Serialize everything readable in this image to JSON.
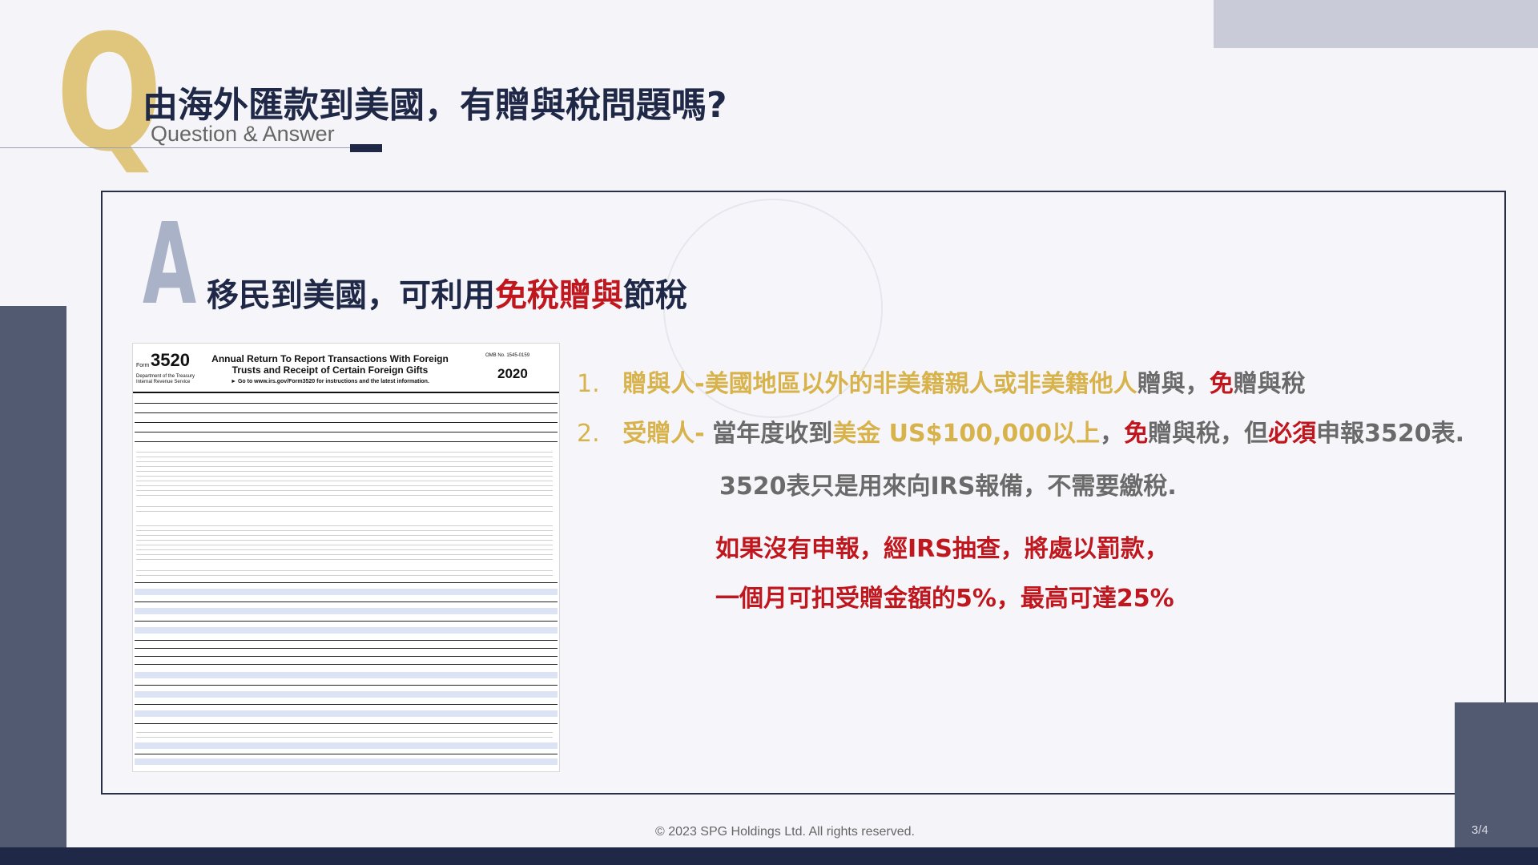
{
  "header": {
    "q_letter": "Q",
    "title": "由海外匯款到美國，有贈與稅問題嗎?",
    "subtitle": "Question & Answer"
  },
  "answer": {
    "a_letter": "A",
    "title_part1": "移民到美國，可利用",
    "title_red": "免稅贈與",
    "title_part2": "節稅"
  },
  "form_image": {
    "form_label": "Form",
    "form_number": "3520",
    "dept": "Department of the Treasury Internal Revenue Service",
    "title": "Annual Return To Report Transactions With Foreign Trusts and Receipt of Certain Foreign Gifts",
    "goto": "► Go to www.irs.gov/Form3520 for instructions and the latest information.",
    "omb": "OMB No. 1545-0159",
    "year": "2020"
  },
  "items": [
    {
      "num": "1.",
      "label": "贈與人-",
      "highlight": "美國地區以外的非美籍親人或非美籍他人",
      "text1": "贈與，",
      "red": "免",
      "text2": "贈與稅"
    },
    {
      "num": "2.",
      "label": "受贈人-",
      "text1": "當年度收到",
      "highlight": "美金 US$100,000以上",
      "text2": "，",
      "red1": "免",
      "text3": "贈與稅，但",
      "red2": "必須",
      "text4": "申報3520表.",
      "line2": "3520表只是用來向IRS報備，不需要繳稅."
    }
  ],
  "warning": {
    "line1": "如果沒有申報，經IRS抽查，將處以罰款，",
    "line2": "一個月可扣受贈金額的5%，最高可達25%"
  },
  "footer": {
    "copyright": "© 2023 SPG Holdings Ltd. All rights reserved.",
    "page": "3/4"
  },
  "colors": {
    "navy": "#1f2846",
    "gold": "#d8b34c",
    "red": "#c0161d",
    "slate": "#525a72"
  }
}
